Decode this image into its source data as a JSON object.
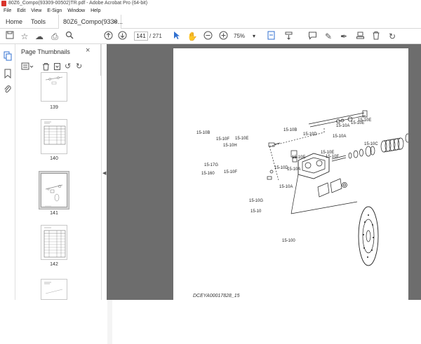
{
  "window": {
    "title": "80Z6_Compo(93309-00502)TR.pdf - Adobe Acrobat Pro (64-bit)"
  },
  "menu": [
    "File",
    "Edit",
    "View",
    "E-Sign",
    "Window",
    "Help"
  ],
  "tabs": {
    "home": "Home",
    "tools": "Tools",
    "document": "80Z6_Compo(9330...",
    "close": "×"
  },
  "toolbar": {
    "page_current": "141",
    "page_total": "/ 271",
    "zoom": "75%"
  },
  "panel": {
    "title": "Page Thumbnails",
    "close": "×",
    "thumbnails": [
      {
        "label": "139"
      },
      {
        "label": "140"
      },
      {
        "label": "141"
      },
      {
        "label": "142"
      }
    ]
  },
  "document": {
    "footer": "DCEYA00017828_15",
    "callouts": [
      "15-10B",
      "15-10F",
      "15-10E",
      "15-10H",
      "15-10B",
      "15-10D",
      "15-10A",
      "15-10E",
      "15-10A",
      "15-10C",
      "15-10E",
      "15-10E",
      "15-17G",
      "15-10F",
      "15-10E",
      "15-10D",
      "15-10A",
      "15-10E",
      "15-160",
      "15-10A",
      "15-10G",
      "15-10",
      "15-100"
    ]
  },
  "colors": {
    "accent": "#2f6fd0",
    "doc_background": "#6d6d6d",
    "pdf_icon": "#d9342b"
  }
}
